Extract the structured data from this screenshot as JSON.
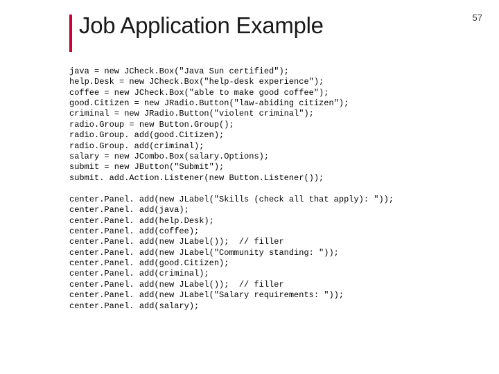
{
  "pageNumber": "57",
  "title": "Job Application Example",
  "code1": "java = new JCheck.Box(\"Java Sun certified\");\nhelp.Desk = new JCheck.Box(\"help-desk experience\");\ncoffee = new JCheck.Box(\"able to make good coffee\");\ngood.Citizen = new JRadio.Button(\"law-abiding citizen\");\ncriminal = new JRadio.Button(\"violent criminal\");\nradio.Group = new Button.Group();\nradio.Group. add(good.Citizen);\nradio.Group. add(criminal);\nsalary = new JCombo.Box(salary.Options);\nsubmit = new JButton(\"Submit\");\nsubmit. add.Action.Listener(new Button.Listener());",
  "code2": "center.Panel. add(new JLabel(\"Skills (check all that apply): \"));\ncenter.Panel. add(java);\ncenter.Panel. add(help.Desk);\ncenter.Panel. add(coffee);\ncenter.Panel. add(new JLabel());  // filler\ncenter.Panel. add(new JLabel(\"Community standing: \"));\ncenter.Panel. add(good.Citizen);\ncenter.Panel. add(criminal);\ncenter.Panel. add(new JLabel());  // filler\ncenter.Panel. add(new JLabel(\"Salary requirements: \"));\ncenter.Panel. add(salary);"
}
